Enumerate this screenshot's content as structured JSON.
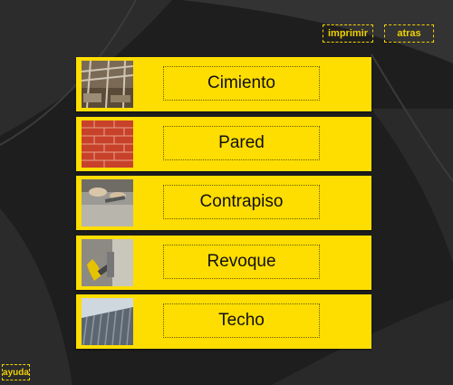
{
  "top_buttons": {
    "print": "imprimir",
    "back": "atras"
  },
  "menu": {
    "items": [
      {
        "label": "Cimiento",
        "image": "foundation-photo"
      },
      {
        "label": "Pared",
        "image": "brick-wall-photo"
      },
      {
        "label": "Contrapiso",
        "image": "subfloor-photo"
      },
      {
        "label": "Revoque",
        "image": "plastering-photo"
      },
      {
        "label": "Techo",
        "image": "roof-photo"
      }
    ]
  },
  "help": "ayuda",
  "colors": {
    "accent": "#fedd00",
    "background": "#1c1c1c",
    "button_text": "#f0d000"
  }
}
